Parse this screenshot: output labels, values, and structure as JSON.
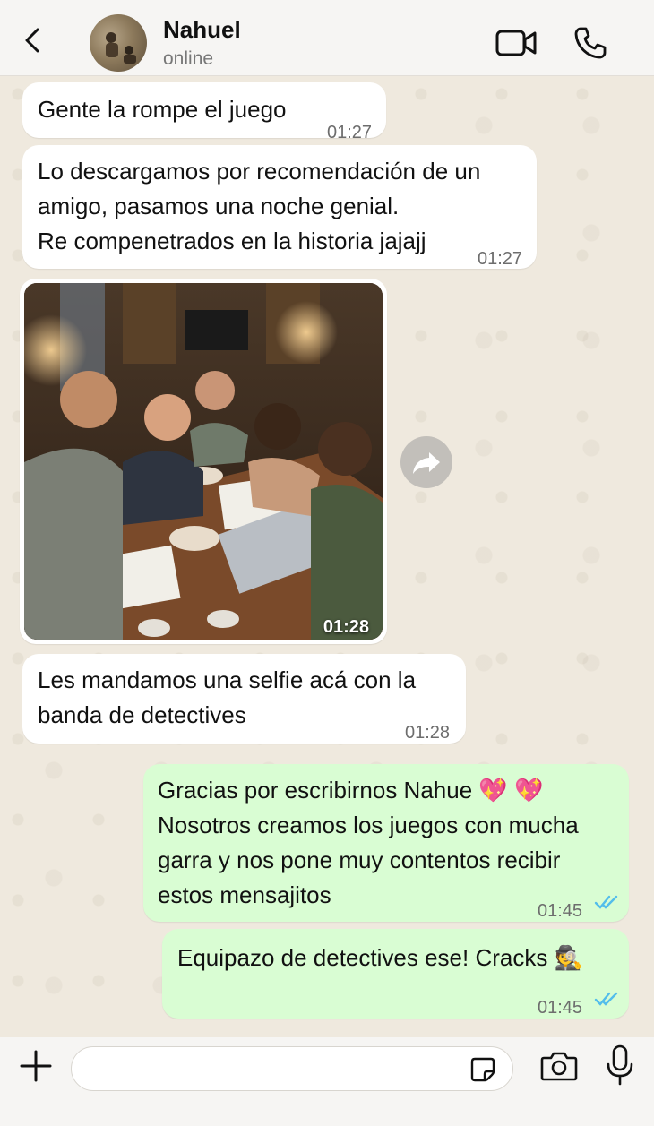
{
  "contact": {
    "name": "Nahuel",
    "status": "online"
  },
  "messages": [
    {
      "direction": "in",
      "text": "Gente la rompe el juego",
      "time": "01:27"
    },
    {
      "direction": "in",
      "text": "Lo descargamos por recomendación de un\namigo, pasamos una noche genial.\nRe compenetrados en la historia jajajj",
      "time": "01:27"
    },
    {
      "direction": "in",
      "type": "image",
      "time": "01:28"
    },
    {
      "direction": "in",
      "text": "Les mandamos una selfie acá con la\nbanda de detectives",
      "time": "01:28"
    },
    {
      "direction": "out",
      "text": "Gracias por escribirnos Nahue 💖 💖\nNosotros creamos los juegos con mucha\ngarra  y nos pone muy contentos recibir\nestos mensajitos",
      "time": "01:45",
      "read": true
    },
    {
      "direction": "out",
      "text": "Equipazo de detectives ese! Cracks 🕵",
      "time": "01:45",
      "read": true
    }
  ],
  "input": {
    "value": "",
    "placeholder": ""
  },
  "icons": {
    "back": "back-arrow-icon",
    "video": "video-call-icon",
    "phone": "phone-call-icon",
    "forward": "forward-icon",
    "plus": "plus-icon",
    "sticker": "sticker-icon",
    "camera": "camera-icon",
    "mic": "microphone-icon",
    "read": "double-check-icon"
  },
  "colors": {
    "outgoing_bubble": "#d9fdd3",
    "incoming_bubble": "#ffffff",
    "read_ticks": "#53bdeb"
  }
}
